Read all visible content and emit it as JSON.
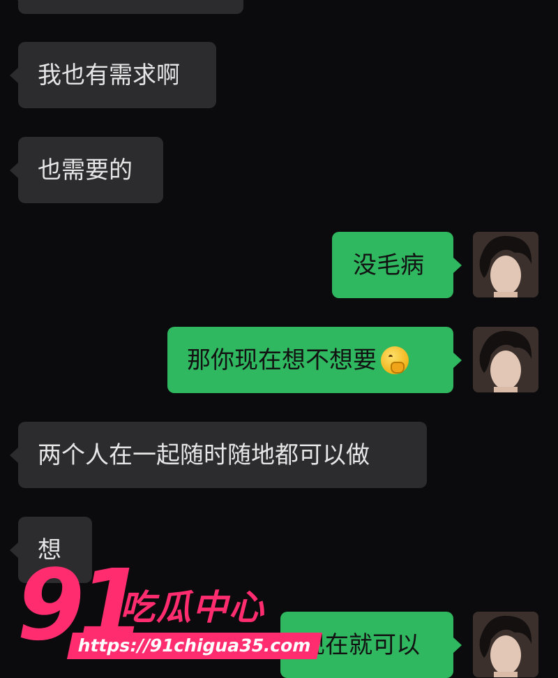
{
  "messages": [
    {
      "side": "in",
      "text": "我也有需求啊"
    },
    {
      "side": "in",
      "text": "也需要的"
    },
    {
      "side": "out",
      "text": "没毛病"
    },
    {
      "side": "out",
      "text": "那你现在想不想要"
    },
    {
      "side": "in",
      "text": "两个人在一起随时随地都可以做"
    },
    {
      "side": "in",
      "text": "想"
    },
    {
      "side": "out",
      "text": "现在就可以"
    }
  ],
  "icons": {
    "emoji": "thinking-face-icon",
    "avatar": "user-avatar-photo"
  },
  "watermark": {
    "number": "91",
    "name": "吃瓜中心",
    "url": "https://91chigua35.com"
  },
  "colors": {
    "background": "#0b0b0d",
    "incoming_bubble": "#2c2c2e",
    "outgoing_bubble": "#2fb860",
    "watermark": "#ff2d6f"
  }
}
